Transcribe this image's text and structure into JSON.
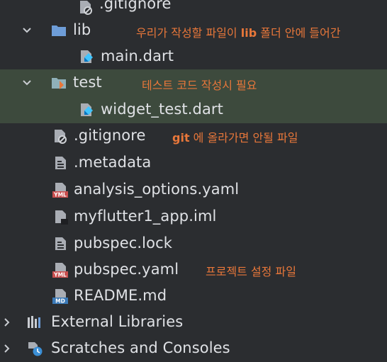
{
  "tree": {
    "rows": [
      {
        "label": ".gitignore",
        "note": ""
      },
      {
        "label": "lib",
        "note_bold": "lib",
        "note_pre": "우리가 작성할 파일이 ",
        "note_post": " 폴더 안에 들어간"
      },
      {
        "label": "main.dart",
        "note": ""
      },
      {
        "label": "test",
        "note": "테스트 코드 작성시 필요"
      },
      {
        "label": "widget_test.dart",
        "note": ""
      },
      {
        "label": ".gitignore",
        "note_bold": "git",
        "note_post": " 에 올라가면 안될 파일"
      },
      {
        "label": ".metadata",
        "note": ""
      },
      {
        "label": "analysis_options.yaml",
        "note": ""
      },
      {
        "label": "myflutter1_app.iml",
        "note": ""
      },
      {
        "label": "pubspec.lock",
        "note": ""
      },
      {
        "label": "pubspec.yaml",
        "note": "프로젝트 설정 파일"
      },
      {
        "label": "README.md",
        "note": ""
      },
      {
        "label": "External Libraries",
        "note": ""
      },
      {
        "label": "Scratches and Consoles",
        "note": ""
      }
    ],
    "icons": {
      "gitignore": "gitignore-file-icon",
      "folder": "folder-icon",
      "dart": "dart-file-icon",
      "test_folder": "test-folder-icon",
      "text": "text-file-icon",
      "yaml": "yaml-file-icon",
      "iml": "iml-file-icon",
      "md": "markdown-file-icon",
      "libs": "libraries-icon",
      "scratches": "scratches-icon"
    },
    "colors": {
      "background": "#2b2d30",
      "highlight": "#3d4a3d",
      "annotation": "#e8773a",
      "text": "#dfe1e5"
    }
  }
}
